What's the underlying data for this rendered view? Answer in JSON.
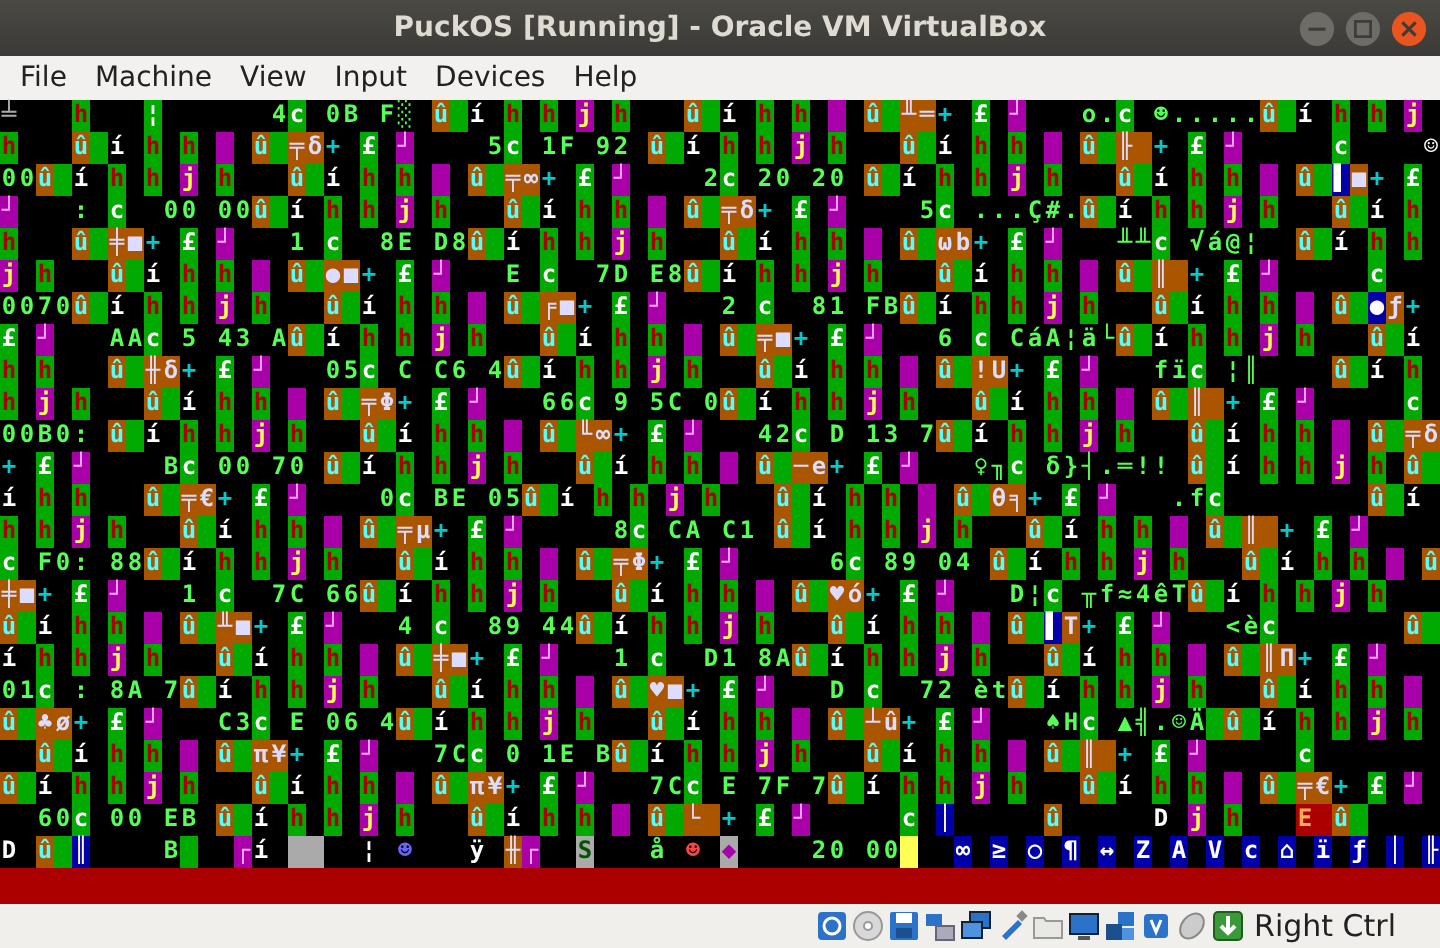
{
  "window": {
    "title": "PuckOS [Running] - Oracle VM VirtualBox"
  },
  "menu": [
    "File",
    "Machine",
    "View",
    "Input",
    "Devices",
    "Help"
  ],
  "console": {
    "lines": [
      {
        "runs": [
          {
            "text": "╧   ",
            "kind": "ash"
          },
          {
            "text": "h   ",
            "kind": "leaf"
          },
          {
            "text": "¦",
            "kind": "lime"
          },
          {
            "text": "      4",
            "kind": "plain"
          },
          {
            "text": "c",
            "kind": "lime"
          },
          {
            "text": " 0B F░ ",
            "kind": "plain"
          },
          {
            "text": "û í h h j h   ",
            "kind": "cluster"
          },
          {
            "text": "û í h h   ",
            "kind": "cluster"
          },
          {
            "text": "û ╨═+ £ ┘   ",
            "kind": "stamp"
          },
          {
            "text": "o.",
            "kind": "plain"
          },
          {
            "text": "c",
            "kind": "lime"
          },
          {
            "text": " ☻.....",
            "kind": "plain"
          },
          {
            "text": "û í h h j ",
            "kind": "cluster"
          }
        ]
      },
      {
        "runs": [
          {
            "text": "h   ",
            "kind": "leaf"
          },
          {
            "text": "û í h h   ",
            "kind": "cluster"
          },
          {
            "text": "û ╤δ+ £ ┘    ",
            "kind": "stamp"
          },
          {
            "text": "5",
            "kind": "plain"
          },
          {
            "text": "c",
            "kind": "lime"
          },
          {
            "text": " 1F 92 ",
            "kind": "plain"
          },
          {
            "text": "û í h h j h   ",
            "kind": "cluster"
          },
          {
            "text": "û í h h   ",
            "kind": "cluster"
          },
          {
            "text": "û ╟ + £ ┘     ",
            "kind": "stamp"
          },
          {
            "text": "c",
            "kind": "lime"
          },
          {
            "text": "    ☺",
            "kind": "white"
          }
        ]
      },
      {
        "runs": [
          {
            "text": "00",
            "kind": "plain"
          },
          {
            "text": "û í h h j h   ",
            "kind": "cluster"
          },
          {
            "text": "û í h h   ",
            "kind": "cluster"
          },
          {
            "text": "û ╤∞+ £ ┘    2",
            "kind": "stamp"
          },
          {
            "text": "c",
            "kind": "lime"
          },
          {
            "text": " 20 20 ",
            "kind": "plain"
          },
          {
            "text": "û í h h j h   ",
            "kind": "cluster"
          },
          {
            "text": "û í h h   ",
            "kind": "cluster"
          },
          {
            "text": "û ▌■+ £ ",
            "kind": "bluestamp"
          }
        ]
      },
      {
        "runs": [
          {
            "text": "┘",
            "kind": "orchid"
          },
          {
            "text": "   : ",
            "kind": "plain"
          },
          {
            "text": "c",
            "kind": "lime"
          },
          {
            "text": "  00 00",
            "kind": "plain"
          },
          {
            "text": "û í h h j h   ",
            "kind": "cluster"
          },
          {
            "text": "û í h h   ",
            "kind": "cluster"
          },
          {
            "text": "û ╤δ+ £ ┘    ",
            "kind": "stamp"
          },
          {
            "text": "5",
            "kind": "plain"
          },
          {
            "text": "c",
            "kind": "lime"
          },
          {
            "text": " ...Ç#.",
            "kind": "plain"
          },
          {
            "text": "û í h h j h   ",
            "kind": "cluster"
          },
          {
            "text": "û í h ",
            "kind": "cluster"
          }
        ]
      },
      {
        "runs": [
          {
            "text": "h   ",
            "kind": "leaf"
          },
          {
            "text": "û ╪■+ £ ┘   1 ",
            "kind": "stamp"
          },
          {
            "text": "c",
            "kind": "lime"
          },
          {
            "text": "  8E D8",
            "kind": "plain"
          },
          {
            "text": "û í h h j h   ",
            "kind": "cluster"
          },
          {
            "text": "û í h h   ",
            "kind": "cluster"
          },
          {
            "text": "û ωb+ £ ┘   ╨╨",
            "kind": "stamp"
          },
          {
            "text": "c",
            "kind": "lime"
          },
          {
            "text": " √á@¦  ",
            "kind": "plain"
          },
          {
            "text": "û í h h ",
            "kind": "cluster"
          }
        ]
      },
      {
        "runs": [
          {
            "text": "j ",
            "kind": "grape"
          },
          {
            "text": "h   ",
            "kind": "leaf"
          },
          {
            "text": "û í h h   ",
            "kind": "cluster"
          },
          {
            "text": "û ●■+ £ ┘   E ",
            "kind": "stamp"
          },
          {
            "text": "c",
            "kind": "lime"
          },
          {
            "text": "  7D E8",
            "kind": "plain"
          },
          {
            "text": "û í h h j h   ",
            "kind": "cluster"
          },
          {
            "text": "û í h h   ",
            "kind": "cluster"
          },
          {
            "text": "û ║ + £ ┘     ",
            "kind": "stamp"
          },
          {
            "text": "c   ",
            "kind": "lime"
          }
        ]
      },
      {
        "runs": [
          {
            "text": "0070",
            "kind": "plain"
          },
          {
            "text": "û í h h j h   ",
            "kind": "cluster"
          },
          {
            "text": "û í h h   ",
            "kind": "cluster"
          },
          {
            "text": "û ╒■+ £ ┘   2 ",
            "kind": "stamp"
          },
          {
            "text": "c",
            "kind": "lime"
          },
          {
            "text": "  81 FB",
            "kind": "plain"
          },
          {
            "text": "û í h h j h   ",
            "kind": "cluster"
          },
          {
            "text": "û í h h   ",
            "kind": "cluster"
          },
          {
            "text": "û ●ƒ+ ",
            "kind": "bluestamp"
          }
        ]
      },
      {
        "runs": [
          {
            "text": "£ ",
            "kind": "lime"
          },
          {
            "text": "┘",
            "kind": "orchid"
          },
          {
            "text": "   AA",
            "kind": "plain"
          },
          {
            "text": "c",
            "kind": "lime"
          },
          {
            "text": " 5 43 A",
            "kind": "plain"
          },
          {
            "text": "û í h h j h   ",
            "kind": "cluster"
          },
          {
            "text": "û í h h   ",
            "kind": "cluster"
          },
          {
            "text": "û ╤■+ £ ┘   6 ",
            "kind": "stamp"
          },
          {
            "text": "c",
            "kind": "lime"
          },
          {
            "text": " CáA¦ä└",
            "kind": "plain"
          },
          {
            "text": "û í h h j h   ",
            "kind": "cluster"
          },
          {
            "text": "û í ",
            "kind": "cluster"
          }
        ]
      },
      {
        "runs": [
          {
            "text": "h ",
            "kind": "leaf"
          },
          {
            "text": "h   ",
            "kind": "leaf"
          },
          {
            "text": "û ╫δ+ £ ┘   05",
            "kind": "stamp"
          },
          {
            "text": "c",
            "kind": "lime"
          },
          {
            "text": " C C6 4",
            "kind": "plain"
          },
          {
            "text": "û í h h j h   ",
            "kind": "cluster"
          },
          {
            "text": "û í h h   ",
            "kind": "cluster"
          },
          {
            "text": "û !U+ £ ┘   fï",
            "kind": "stamp"
          },
          {
            "text": "c",
            "kind": "lime"
          },
          {
            "text": " ¦║    ",
            "kind": "plain"
          },
          {
            "text": "û í h ",
            "kind": "cluster"
          }
        ]
      },
      {
        "runs": [
          {
            "text": "h ",
            "kind": "leaf"
          },
          {
            "text": "j ",
            "kind": "grape"
          },
          {
            "text": "h   ",
            "kind": "leaf"
          },
          {
            "text": "û í h h   ",
            "kind": "cluster"
          },
          {
            "text": "û ╤Φ+ £ ┘   66",
            "kind": "stamp"
          },
          {
            "text": "c",
            "kind": "lime"
          },
          {
            "text": " 9 5C 0",
            "kind": "plain"
          },
          {
            "text": "û í h h j h   ",
            "kind": "cluster"
          },
          {
            "text": "û í h h   ",
            "kind": "cluster"
          },
          {
            "text": "û ║ + £ ┘     ",
            "kind": "stamp"
          },
          {
            "text": "c ",
            "kind": "lime"
          }
        ]
      },
      {
        "runs": [
          {
            "text": "00B0: ",
            "kind": "plain"
          },
          {
            "text": "û í h h j h   ",
            "kind": "cluster"
          },
          {
            "text": "û í h h   ",
            "kind": "cluster"
          },
          {
            "text": "û ╙∞+ £ ┘   42",
            "kind": "stamp"
          },
          {
            "text": "c",
            "kind": "lime"
          },
          {
            "text": " D 13 7",
            "kind": "plain"
          },
          {
            "text": "û í h h j h   ",
            "kind": "cluster"
          },
          {
            "text": "û í h h   ",
            "kind": "cluster"
          },
          {
            "text": "û ╤δ",
            "kind": "stamp"
          }
        ]
      },
      {
        "runs": [
          {
            "text": "+ ",
            "kind": "teal"
          },
          {
            "text": "£ ",
            "kind": "lime"
          },
          {
            "text": "┘",
            "kind": "orchid"
          },
          {
            "text": "    B",
            "kind": "plain"
          },
          {
            "text": "c",
            "kind": "lime"
          },
          {
            "text": " 00 70 ",
            "kind": "plain"
          },
          {
            "text": "û í h h j h   ",
            "kind": "cluster"
          },
          {
            "text": "û í h h   ",
            "kind": "cluster"
          },
          {
            "text": "û ─e+ £ ┘   ♀╖",
            "kind": "stamp"
          },
          {
            "text": "c",
            "kind": "lime"
          },
          {
            "text": " δ}┤.═!! ",
            "kind": "plain"
          },
          {
            "text": "û í h h j h ",
            "kind": "cluster"
          },
          {
            "text": "û ",
            "kind": "cluster"
          }
        ]
      },
      {
        "runs": [
          {
            "text": "í ",
            "kind": "white"
          },
          {
            "text": "h ",
            "kind": "leaf"
          },
          {
            "text": "h   ",
            "kind": "leaf"
          },
          {
            "text": "û ╤€+ £ ┘    0",
            "kind": "stamp"
          },
          {
            "text": "c",
            "kind": "lime"
          },
          {
            "text": " BE 05",
            "kind": "plain"
          },
          {
            "text": "û í h h j h   ",
            "kind": "cluster"
          },
          {
            "text": "û í h h   ",
            "kind": "cluster"
          },
          {
            "text": "û θ╕+ £ ┘   .f",
            "kind": "stamp"
          },
          {
            "text": "c        ",
            "kind": "lime"
          },
          {
            "text": "û í ",
            "kind": "cluster"
          }
        ]
      },
      {
        "runs": [
          {
            "text": "h ",
            "kind": "leaf"
          },
          {
            "text": "h ",
            "kind": "leaf"
          },
          {
            "text": "j ",
            "kind": "grape"
          },
          {
            "text": "h   ",
            "kind": "leaf"
          },
          {
            "text": "û í h h   ",
            "kind": "cluster"
          },
          {
            "text": "û ╤μ+ £ ┘     8",
            "kind": "stamp"
          },
          {
            "text": "c",
            "kind": "lime"
          },
          {
            "text": " CA C1 ",
            "kind": "plain"
          },
          {
            "text": "û í h h j h   ",
            "kind": "cluster"
          },
          {
            "text": "û í h h   ",
            "kind": "cluster"
          },
          {
            "text": "û ║ + £ ┘     ",
            "kind": "stamp"
          }
        ]
      },
      {
        "runs": [
          {
            "text": "c",
            "kind": "lime"
          },
          {
            "text": " F0: 88",
            "kind": "plain"
          },
          {
            "text": "û í h h j h   ",
            "kind": "cluster"
          },
          {
            "text": "û í h h   ",
            "kind": "cluster"
          },
          {
            "text": "û ╤Φ+ £ ┘     6",
            "kind": "stamp"
          },
          {
            "text": "c",
            "kind": "lime"
          },
          {
            "text": " 89 04 ",
            "kind": "plain"
          },
          {
            "text": "û í h h j h   ",
            "kind": "cluster"
          },
          {
            "text": "û í h h   ",
            "kind": "cluster"
          },
          {
            "text": "û ",
            "kind": "cluster"
          }
        ]
      },
      {
        "runs": [
          {
            "text": "╪■",
            "kind": "rust"
          },
          {
            "text": "+ ",
            "kind": "teal"
          },
          {
            "text": "£ ",
            "kind": "lime"
          },
          {
            "text": "┘",
            "kind": "orchid"
          },
          {
            "text": "   1 ",
            "kind": "plain"
          },
          {
            "text": "c",
            "kind": "lime"
          },
          {
            "text": "  7C 66",
            "kind": "plain"
          },
          {
            "text": "û í h h j h   ",
            "kind": "cluster"
          },
          {
            "text": "û í h h   ",
            "kind": "cluster"
          },
          {
            "text": "û ♥ó+ £ ┘   D¦",
            "kind": "stamp"
          },
          {
            "text": "c",
            "kind": "lime"
          },
          {
            "text": " ╥f≈4êT",
            "kind": "plain"
          },
          {
            "text": "û í h h j h   ",
            "kind": "cluster"
          }
        ]
      },
      {
        "runs": [
          {
            "text": "û í h h   ",
            "kind": "cluster"
          },
          {
            "text": "û ╨■+ £ ┘   4 ",
            "kind": "stamp"
          },
          {
            "text": "c",
            "kind": "lime"
          },
          {
            "text": "  89 44",
            "kind": "plain"
          },
          {
            "text": "û í h h j h   ",
            "kind": "cluster"
          },
          {
            "text": "û í h h   ",
            "kind": "cluster"
          },
          {
            "text": "û ▌T+ £ ┘   <è",
            "kind": "bluestamp"
          },
          {
            "text": "c       ",
            "kind": "lime"
          },
          {
            "text": "û ",
            "kind": "cluster"
          }
        ]
      },
      {
        "runs": [
          {
            "text": "í ",
            "kind": "white"
          },
          {
            "text": "h ",
            "kind": "leaf"
          },
          {
            "text": "h ",
            "kind": "leaf"
          },
          {
            "text": "j ",
            "kind": "grape"
          },
          {
            "text": "h   ",
            "kind": "leaf"
          },
          {
            "text": "û í h h   ",
            "kind": "cluster"
          },
          {
            "text": "û ╪■+ £ ┘   1 ",
            "kind": "stamp"
          },
          {
            "text": "c",
            "kind": "lime"
          },
          {
            "text": "  D1 8A",
            "kind": "plain"
          },
          {
            "text": "û í h h j h   ",
            "kind": "cluster"
          },
          {
            "text": "û í h h   ",
            "kind": "cluster"
          },
          {
            "text": "û ║Π+ £ ┘   ",
            "kind": "stamp"
          }
        ]
      },
      {
        "runs": [
          {
            "text": "01",
            "kind": "plain"
          },
          {
            "text": "c",
            "kind": "lime"
          },
          {
            "text": " : 8A 7",
            "kind": "plain"
          },
          {
            "text": "û í h h j h   ",
            "kind": "cluster"
          },
          {
            "text": "û í h h   ",
            "kind": "cluster"
          },
          {
            "text": "û ♥■+ £ ┘   D ",
            "kind": "stamp"
          },
          {
            "text": "c",
            "kind": "lime"
          },
          {
            "text": "  72 èt",
            "kind": "plain"
          },
          {
            "text": "û í h h j h   ",
            "kind": "cluster"
          },
          {
            "text": "û í h h   ",
            "kind": "cluster"
          }
        ]
      },
      {
        "runs": [
          {
            "text": "û ♣ø+ £ ┘   C3",
            "kind": "stamp"
          },
          {
            "text": "c",
            "kind": "lime"
          },
          {
            "text": " E 06 4",
            "kind": "plain"
          },
          {
            "text": "û í h h j h   ",
            "kind": "cluster"
          },
          {
            "text": "û í h h   ",
            "kind": "cluster"
          },
          {
            "text": "û ┴û+ £ ┘   ♠H",
            "kind": "stamp"
          },
          {
            "text": "c",
            "kind": "lime"
          },
          {
            "text": " ▲╣.☺Ä",
            "kind": "plain"
          },
          {
            "kind": "pad"
          },
          {
            "text": "û í h h j h ",
            "kind": "cluster"
          }
        ]
      },
      {
        "runs": [
          {
            "kind": "blank"
          },
          {
            "kind": "blank"
          },
          {
            "text": "û í h h   ",
            "kind": "cluster"
          },
          {
            "text": "û π¥+ £ ┘   7C",
            "kind": "stamp"
          },
          {
            "text": "c",
            "kind": "lime"
          },
          {
            "text": " 0 1E B",
            "kind": "plain"
          },
          {
            "text": "û í h h j h   ",
            "kind": "cluster"
          },
          {
            "text": "û í h h   ",
            "kind": "cluster"
          },
          {
            "text": "û ║ + £ ┘     ",
            "kind": "stamp"
          },
          {
            "text": "c       ",
            "kind": "lime"
          }
        ]
      },
      {
        "runs": [
          {
            "text": "û í h h j h   ",
            "kind": "cluster"
          },
          {
            "text": "û í h h   ",
            "kind": "cluster"
          },
          {
            "text": "û π¥+ £ ┘   7C",
            "kind": "stamp"
          },
          {
            "text": "c",
            "kind": "lime"
          },
          {
            "text": " E 7F 7",
            "kind": "plain"
          },
          {
            "text": "û í h h j h   ",
            "kind": "cluster"
          },
          {
            "text": "û í h h   ",
            "kind": "cluster"
          },
          {
            "text": "û ╤€+ £ ┘ ",
            "kind": "stamp"
          }
        ]
      },
      {
        "runs": [
          {
            "text": "  60",
            "kind": "plain"
          },
          {
            "text": "c",
            "kind": "lime"
          },
          {
            "text": " 00 EB ",
            "kind": "plain"
          },
          {
            "text": "û í h h j h   ",
            "kind": "cluster"
          },
          {
            "text": "û í h h   ",
            "kind": "cluster"
          },
          {
            "text": "û └ + £ ┘     ",
            "kind": "stamp"
          },
          {
            "text": "c ",
            "kind": "lime"
          },
          {
            "text": "│",
            "kind": "navy"
          },
          {
            "text": "     û",
            "kind": "brown"
          },
          {
            "text": "     D ",
            "kind": "white"
          },
          {
            "text": "j ",
            "kind": "grape"
          },
          {
            "text": "h   ",
            "kind": "leaf"
          },
          {
            "text": "E ",
            "kind": "ruby"
          },
          {
            "text": "û ",
            "kind": "cluster"
          }
        ]
      },
      {
        "runs": [
          {
            "text": "D ",
            "kind": "white"
          },
          {
            "text": "û ",
            "kind": "cluster"
          },
          {
            "text": "║",
            "kind": "navy"
          },
          {
            "text": "    B",
            "kind": "plain"
          },
          {
            "kind": "pad"
          },
          {
            "kind": "blank"
          },
          {
            "kind": "blank"
          },
          {
            "text": "┌",
            "kind": "orchid"
          },
          {
            "text": "í ",
            "kind": "white"
          },
          {
            "kind": "stone"
          },
          {
            "kind": "stone"
          },
          {
            "text": "  ¦ ",
            "kind": "white"
          },
          {
            "text": "☻   ",
            "kind": "ink"
          },
          {
            "text": "ÿ ",
            "kind": "white"
          },
          {
            "text": "╫",
            "kind": "rust"
          },
          {
            "text": "┌  ",
            "kind": "orchid"
          },
          {
            "text": "S",
            "kind": "silver"
          },
          {
            "text": "   å ",
            "kind": "plain"
          },
          {
            "text": "☻ ",
            "kind": "crimson"
          },
          {
            "text": "◆",
            "kind": "blush"
          },
          {
            "text": "    20 00",
            "kind": "plain"
          },
          {
            "kind": "lemon"
          },
          {
            "kind": "blank"
          },
          {
            "kind": "blank"
          },
          {
            "text": "∞ ≥ ○ ¶ ↔ Z A V c ⌂ ï ƒ │ ╟ ",
            "kind": "keys"
          }
        ]
      }
    ]
  },
  "status_bar": {
    "host_key": "Right Ctrl"
  }
}
